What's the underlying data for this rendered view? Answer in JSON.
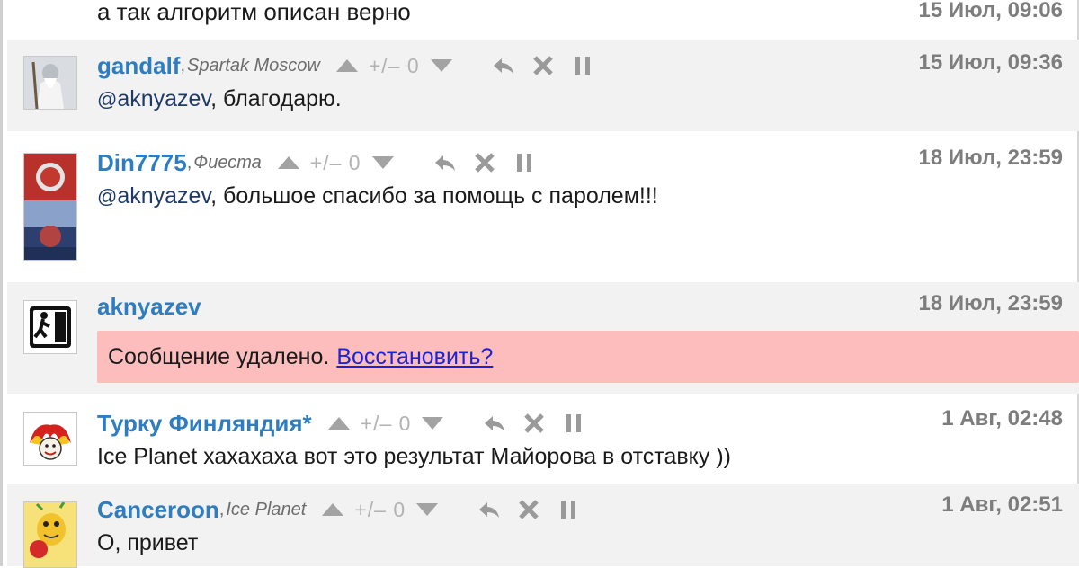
{
  "top_fragment": {
    "text": "а так алгоритм описан верно",
    "date": "15 Июл, 09:06"
  },
  "comments": [
    {
      "author": "gandalf",
      "team_sep": ",",
      "team": "Spartak Moscow",
      "score": "+/– 0",
      "date": "15 Июл, 09:36",
      "mention": "aknyazev",
      "text": ", благодарю."
    },
    {
      "author": "Din7775",
      "team_sep": ",",
      "team": "Фиеста",
      "score": "+/– 0",
      "date": "18 Июл, 23:59",
      "mention": "aknyazev",
      "text": ", большое спасибо за помощь с паролем!!!"
    },
    {
      "author": "aknyazev",
      "date": "18 Июл, 23:59",
      "deleted_text": "Сообщение удалено.",
      "restore_label": "Восстановить?"
    },
    {
      "author": "Турку Финляндия*",
      "score": "+/– 0",
      "date": "1 Авг, 02:48",
      "text": "Ice Planet хахахаха вот это результат Майорова в отставку ))"
    },
    {
      "author": "Canceroon",
      "team_sep": ",",
      "team": "Ice Planet",
      "score": "+/– 0",
      "date": "1 Авг, 02:51",
      "text": "О, привет"
    }
  ],
  "mention_prefix": "@",
  "icons": {
    "vote_up": "triangle-up-icon",
    "vote_down": "triangle-down-icon",
    "reply": "reply-arrow-icon",
    "delete": "close-x-icon",
    "pause": "pause-icon"
  },
  "colors": {
    "author": "#2f7dc1",
    "deleted_bg": "#fdbdbd",
    "restore_link": "#1a23d6",
    "alt_row": "#f2f2f2",
    "date": "#7d7d7d"
  }
}
